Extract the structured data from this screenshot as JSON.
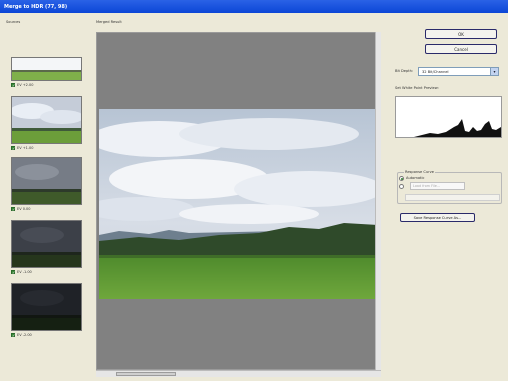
{
  "window": {
    "title": "Merge to HDR (77, 98)"
  },
  "sources": {
    "label": "Sources",
    "items": [
      {
        "label": "EV +2.00",
        "checked": true,
        "exposure": 0.95
      },
      {
        "label": "EV +1.00",
        "checked": true,
        "exposure": 0.75
      },
      {
        "label": "EV 0.00",
        "checked": true,
        "exposure": 0.55
      },
      {
        "label": "EV -1.00",
        "checked": true,
        "exposure": 0.35
      },
      {
        "label": "EV -2.00",
        "checked": true,
        "exposure": 0.18
      }
    ]
  },
  "preview": {
    "label": "Merged Result"
  },
  "buttons": {
    "ok": "OK",
    "cancel": "Cancel"
  },
  "bit_depth": {
    "label": "Bit Depth:",
    "value": "32 Bit/Channel"
  },
  "histogram": {
    "label": "Set White Point Preview:"
  },
  "response_curve": {
    "label": "Response Curve",
    "option_auto": "Automatic",
    "option_load": "Load from File",
    "load_field_placeholder": "Load from File..."
  },
  "save_curve_button": "Save Response Curve As..."
}
